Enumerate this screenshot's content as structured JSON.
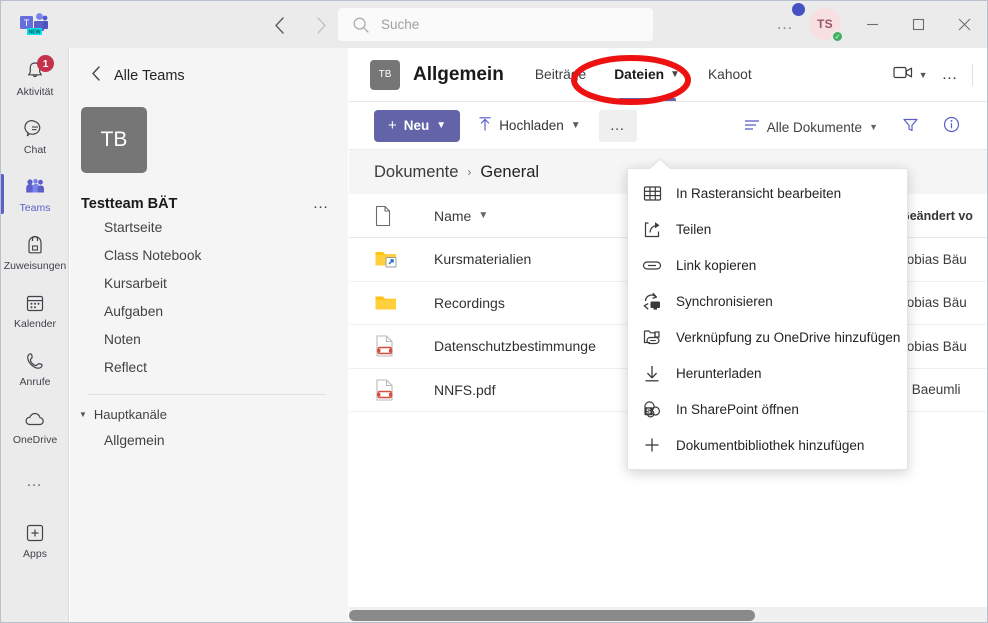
{
  "titlebar": {
    "app_logo": "teams-logo",
    "logo_badge": "NEW",
    "back_icon": "chevron-left-icon",
    "forward_icon": "chevron-right-icon",
    "search": {
      "placeholder": "Suche",
      "value": "",
      "icon": "search-icon"
    },
    "more_options": "…",
    "avatar": {
      "initials": "TS",
      "presence": "available"
    },
    "window": {
      "minimize": "—",
      "maximize": "▢",
      "close": "✕"
    }
  },
  "rail": {
    "items": [
      {
        "label": "Aktivität",
        "icon": "bell-icon",
        "badge": "1",
        "active": false
      },
      {
        "label": "Chat",
        "icon": "chat-icon",
        "badge": "",
        "active": false
      },
      {
        "label": "Teams",
        "icon": "people-icon",
        "badge": "",
        "active": true
      },
      {
        "label": "Zuweisungen",
        "icon": "backpack-icon",
        "badge": "",
        "active": false
      },
      {
        "label": "Kalender",
        "icon": "calendar-icon",
        "badge": "",
        "active": false
      },
      {
        "label": "Anrufe",
        "icon": "phone-icon",
        "badge": "",
        "active": false
      },
      {
        "label": "OneDrive",
        "icon": "cloud-icon",
        "badge": "",
        "active": false
      }
    ],
    "more": "…",
    "apps": {
      "label": "Apps",
      "icon": "plus-box-icon"
    }
  },
  "sidebar": {
    "back_label": "Alle Teams",
    "back_icon": "chevron-left-icon",
    "team": {
      "initials": "TB",
      "name": "Testteam BÄT",
      "more": "…"
    },
    "links": [
      "Startseite",
      "Class Notebook",
      "Kursarbeit",
      "Aufgaben",
      "Noten",
      "Reflect"
    ],
    "group": {
      "label": "Hauptkanäle",
      "expand_icon": "triangle-down-icon"
    },
    "channels": [
      "Allgemein"
    ]
  },
  "channel_header": {
    "avatar_initials": "TB",
    "title": "Allgemein",
    "tabs": [
      {
        "label": "Beiträge",
        "active": false,
        "has_caret": false
      },
      {
        "label": "Dateien",
        "active": true,
        "has_caret": true
      },
      {
        "label": "Kahoot",
        "active": false,
        "has_caret": false
      }
    ],
    "meet_icon": "video-camera-icon",
    "meet_caret": "chevron-down-icon",
    "more_icon": "more-horizontal-icon"
  },
  "toolbar": {
    "new_label": "Neu",
    "new_icon": "plus-icon",
    "new_caret": "chevron-down-icon",
    "upload_label": "Hochladen",
    "upload_icon": "upload-arrow-icon",
    "upload_caret": "chevron-down-icon",
    "overflow_label": "…",
    "view_label": "Alle Dokumente",
    "view_icon": "list-view-icon",
    "view_caret": "chevron-down-icon",
    "filter_icon": "filter-icon",
    "info_icon": "info-circle-icon"
  },
  "breadcrumb": {
    "items": [
      "Dokumente",
      "General"
    ],
    "separator": "›"
  },
  "file_table": {
    "columns": [
      "Name",
      "Geändert vo"
    ],
    "name_sort_icon": "chevron-down-icon",
    "header_icon": "document-icon",
    "rows": [
      {
        "name": "Kursmaterialien",
        "icon": "folder-shortcut-icon",
        "modified_by": "Tobias Bäu"
      },
      {
        "name": "Recordings",
        "icon": "folder-icon",
        "modified_by": "Tobias Bäu"
      },
      {
        "name": "Datenschutzbestimmunge",
        "icon": "pdf-file-icon",
        "modified_by": "Tobias Bäu"
      },
      {
        "name": "NNFS.pdf",
        "icon": "pdf-file-icon",
        "modified_by": "T Baeumli"
      }
    ]
  },
  "context_menu": {
    "items": [
      {
        "label": "In Rasteransicht bearbeiten",
        "icon": "grid-edit-icon"
      },
      {
        "label": "Teilen",
        "icon": "share-icon"
      },
      {
        "label": "Link kopieren",
        "icon": "link-icon"
      },
      {
        "label": "Synchronisieren",
        "icon": "sync-icon"
      },
      {
        "label": "Verknüpfung zu OneDrive hinzufügen",
        "icon": "onedrive-shortcut-icon"
      },
      {
        "label": "Herunterladen",
        "icon": "download-icon"
      },
      {
        "label": "In SharePoint öffnen",
        "icon": "sharepoint-icon"
      },
      {
        "label": "Dokumentbibliothek hinzufügen",
        "icon": "plus-icon"
      }
    ]
  },
  "annotation": {
    "shape": "ellipse",
    "color": "#ee1111",
    "target": "Dateien"
  },
  "colors": {
    "accent": "#6264a7",
    "rail_bg": "#ebebeb",
    "sidebar_bg": "#f5f5f5",
    "badge_red": "#c4314b",
    "presence_green": "#42ae62",
    "folder_yellow": "#ffc20e",
    "pdf_red": "#d94f3d"
  }
}
